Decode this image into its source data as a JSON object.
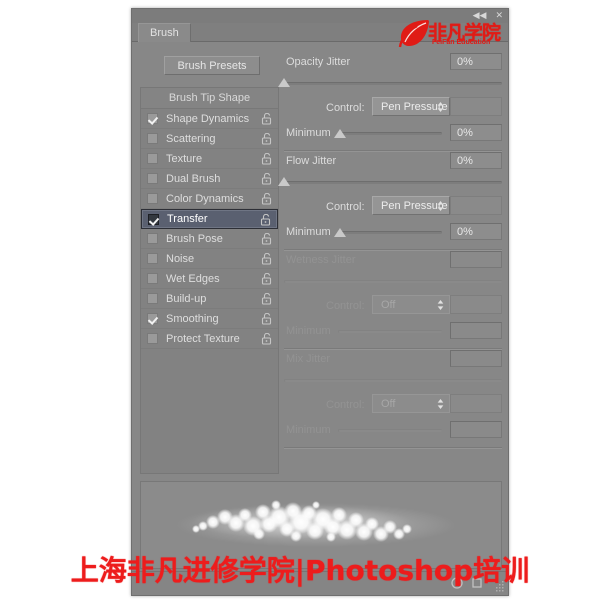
{
  "window": {
    "title": "Brush",
    "controls": [
      {
        "name": "collapse-icon",
        "glyph": "◀◀"
      },
      {
        "name": "close-icon",
        "glyph": "✕"
      }
    ]
  },
  "logo": {
    "cn": "非凡学院",
    "en": "FeiFan Education",
    "color": "#e01b16"
  },
  "toolbar": {
    "brush_presets_label": "Brush Presets"
  },
  "option_list": {
    "header": "Brush Tip Shape",
    "items": [
      {
        "label": "Shape Dynamics",
        "checked": true,
        "selected": false,
        "locked": false
      },
      {
        "label": "Scattering",
        "checked": false,
        "selected": false,
        "locked": false
      },
      {
        "label": "Texture",
        "checked": false,
        "selected": false,
        "locked": false
      },
      {
        "label": "Dual Brush",
        "checked": false,
        "selected": false,
        "locked": false
      },
      {
        "label": "Color Dynamics",
        "checked": false,
        "selected": false,
        "locked": false
      },
      {
        "label": "Transfer",
        "checked": true,
        "selected": true,
        "locked": false
      },
      {
        "label": "Brush Pose",
        "checked": false,
        "selected": false,
        "locked": false
      },
      {
        "label": "Noise",
        "checked": false,
        "selected": false,
        "locked": false
      },
      {
        "label": "Wet Edges",
        "checked": false,
        "selected": false,
        "locked": false
      },
      {
        "label": "Build-up",
        "checked": false,
        "selected": false,
        "locked": false
      },
      {
        "label": "Smoothing",
        "checked": true,
        "selected": false,
        "locked": false
      },
      {
        "label": "Protect Texture",
        "checked": false,
        "selected": false,
        "locked": false
      }
    ]
  },
  "sections": [
    {
      "id": "opacity-jitter",
      "title": "Opacity Jitter",
      "value": "0%",
      "slider_percent": 0,
      "enabled": true,
      "control_label": "Control:",
      "control_value": "Pen Pressure",
      "minimum_label": "Minimum",
      "minimum_value": "0%",
      "minimum_percent": 0
    },
    {
      "id": "flow-jitter",
      "title": "Flow Jitter",
      "value": "0%",
      "slider_percent": 0,
      "enabled": true,
      "control_label": "Control:",
      "control_value": "Pen Pressure",
      "minimum_label": "Minimum",
      "minimum_value": "0%",
      "minimum_percent": 0
    },
    {
      "id": "wetness-jitter",
      "title": "Wetness Jitter",
      "value": "",
      "slider_percent": 0,
      "enabled": false,
      "control_label": "Control:",
      "control_value": "Off",
      "minimum_label": "Minimum",
      "minimum_value": "",
      "minimum_percent": 0
    },
    {
      "id": "mix-jitter",
      "title": "Mix Jitter",
      "value": "",
      "slider_percent": 0,
      "enabled": false,
      "control_label": "Control:",
      "control_value": "Off",
      "minimum_label": "Minimum",
      "minimum_value": "",
      "minimum_percent": 0
    }
  ],
  "preview": {
    "name": "brush-stroke-preview"
  },
  "watermark": {
    "text": "上海非凡进修学院|Photoshop培训",
    "color": "#ed1c1c"
  }
}
